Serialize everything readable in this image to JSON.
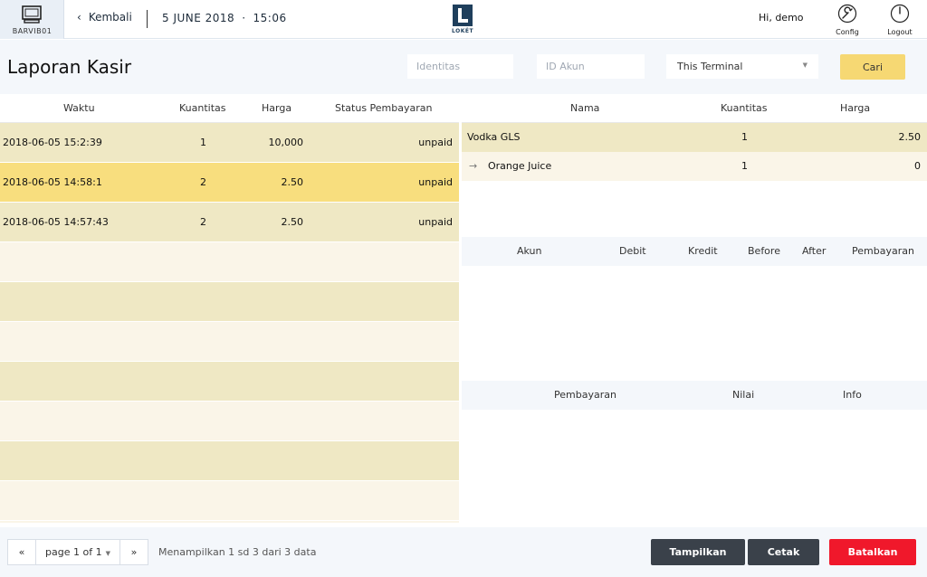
{
  "header": {
    "terminal_name": "BARVIB01",
    "back_label": "Kembali",
    "date": "5 JUNE 2018",
    "separator": "·",
    "time": "15:06",
    "logo_text": "LOKÉT",
    "greeting": "Hi, demo",
    "config_label": "Config",
    "logout_label": "Logout"
  },
  "page": {
    "title": "Laporan Kasir"
  },
  "filters": {
    "identitas_placeholder": "Identitas",
    "id_akun_placeholder": "ID Akun",
    "terminal_selected": "This Terminal",
    "search_label": "Cari"
  },
  "transactions": {
    "columns": [
      "Waktu",
      "Kuantitas",
      "Harga",
      "Status Pembayaran"
    ],
    "rows": [
      {
        "waktu": "2018-06-05 15:2:39",
        "kuantitas": "1",
        "harga": "10,000",
        "status": "unpaid"
      },
      {
        "waktu": "2018-06-05 14:58:1",
        "kuantitas": "2",
        "harga": "2.50",
        "status": "unpaid"
      },
      {
        "waktu": "2018-06-05 14:57:43",
        "kuantitas": "2",
        "harga": "2.50",
        "status": "unpaid"
      }
    ]
  },
  "items": {
    "columns": [
      "Nama",
      "Kuantitas",
      "Harga"
    ],
    "rows": [
      {
        "nama": "Vodka GLS",
        "kuantitas": "1",
        "harga": "2.50"
      },
      {
        "nama": "Orange Juice",
        "kuantitas": "1",
        "harga": "0"
      }
    ]
  },
  "accounts": {
    "columns": [
      "Akun",
      "Debit",
      "Kredit",
      "Before",
      "After",
      "Pembayaran"
    ]
  },
  "payments": {
    "columns": [
      "Pembayaran",
      "Nilai",
      "Info"
    ]
  },
  "footer": {
    "first_label": "«",
    "page_label": "page 1 of 1",
    "last_label": "»",
    "showing_text": "Menampilkan 1 sd 3 dari 3 data",
    "show_label": "Tampilkan",
    "print_label": "Cetak",
    "cancel_label": "Batalkan"
  },
  "colors": {
    "accent_yellow": "#f6d873",
    "selected_row": "#f8de7e",
    "dark_button": "#3a414a",
    "danger_button": "#f0182b"
  }
}
